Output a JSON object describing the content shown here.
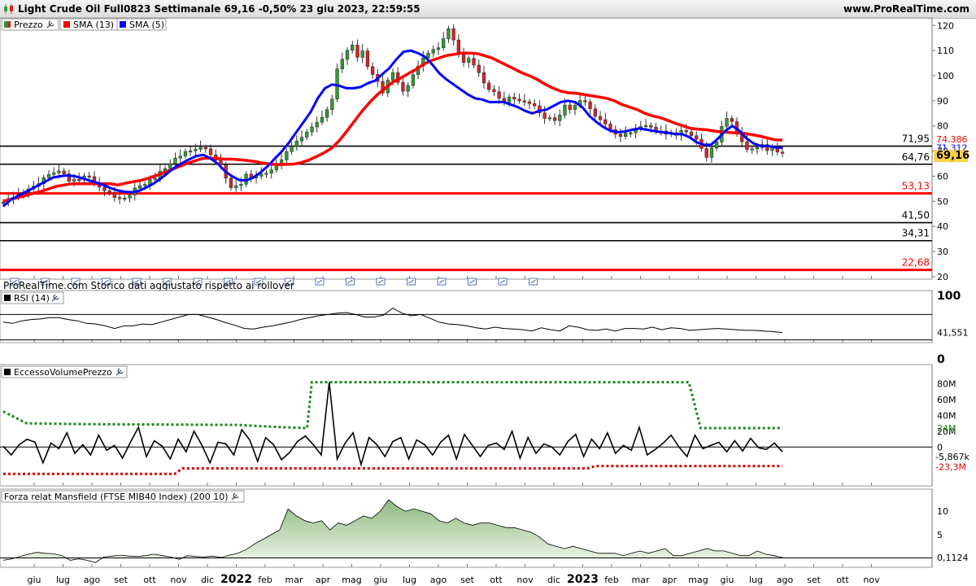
{
  "header": {
    "title": "Light Crude Oil Full0823 Settimanale 69,16 -0,50% 23 giu 2023, 22:59:55",
    "site": "www.ProRealTime.com"
  },
  "colors": {
    "up": "#2e9e2e",
    "down": "#e02020",
    "sma13": "#ff0000",
    "sma5": "#0000ff",
    "hline_black": "#000000",
    "hline_red": "#ff0000",
    "eccesso_line": "#000000",
    "eccesso_upper": "#1a8a1a",
    "eccesso_lower": "#e00000",
    "mansfield_fill": "#b9d6ad",
    "mansfield_line": "#000000",
    "price_label_bg": "#ffd24a"
  },
  "chart_data": [
    {
      "panel": "price",
      "type": "candlestick",
      "legend": [
        {
          "label": "Prezzo",
          "icon": "candle-icon"
        },
        {
          "label": "SMA (13)",
          "color": "#ff0000"
        },
        {
          "label": "SMA (5)",
          "color": "#0000ff"
        }
      ],
      "y_ticks": [
        120,
        110,
        100,
        90,
        80,
        70,
        60,
        50,
        40,
        30,
        20
      ],
      "ylim": [
        19,
        123
      ],
      "x_ticks": [
        "giu",
        "lug",
        "ago",
        "set",
        "ott",
        "nov",
        "dic",
        "2022",
        "feb",
        "mar",
        "apr",
        "mag",
        "giu",
        "lug",
        "ago",
        "set",
        "ott",
        "nov",
        "dic",
        "2023",
        "feb",
        "mar",
        "apr",
        "mag",
        "giu",
        "lug",
        "ago",
        "set",
        "ott",
        "nov"
      ],
      "x_ticks_bold": [
        "2022",
        "2023"
      ],
      "close": [
        49.7,
        51.1,
        51.6,
        52.7,
        53.6,
        54.9,
        56.0,
        57.0,
        59.4,
        60.7,
        61.3,
        62.1,
        60.9,
        58.0,
        58.7,
        58.6,
        60.1,
        59.8,
        57.0,
        55.6,
        54.2,
        53.5,
        51.5,
        51.1,
        51.3,
        52.5,
        55.3,
        56.2,
        56.7,
        58.7,
        59.2,
        62.0,
        63.0,
        65.0,
        67.2,
        68.0,
        69.8,
        70.1,
        70.7,
        71.4,
        70.9,
        68.5,
        66.3,
        64.5,
        59.2,
        55.4,
        56.2,
        56.8,
        60.8,
        59.3,
        60.0,
        60.9,
        61.2,
        62.5,
        64.4,
        66.5,
        69.8,
        71.9,
        74.0,
        75.5,
        77.6,
        79.6,
        81.5,
        83.4,
        86.5,
        90.7,
        102.7,
        106.5,
        110.1,
        112.2,
        107.3,
        109.9,
        103.6,
        100.5,
        97.7,
        93.2,
        98.2,
        101.2,
        97.3,
        93.8,
        96.1,
        100.4,
        103.8,
        107.1,
        109.0,
        110.4,
        111.1,
        114.7,
        118.7,
        114.2,
        108.4,
        105.3,
        106.9,
        104.2,
        101.2,
        97.1,
        94.5,
        93.6,
        91.0,
        89.3,
        91.5,
        90.7,
        90.0,
        89.6,
        88.9,
        88.0,
        85.2,
        83.0,
        83.3,
        82.1,
        84.3,
        88.3,
        86.5,
        88.2,
        90.1,
        89.6,
        86.8,
        83.8,
        82.5,
        80.8,
        78.5,
        76.7,
        75.8,
        77.1,
        77.3,
        79.0,
        79.8,
        80.2,
        79.5,
        77.9,
        78.0,
        76.7,
        77.3,
        76.3,
        78.2,
        77.6,
        76.1,
        74.7,
        71.0,
        67.5,
        71.2,
        73.6,
        79.8,
        83.0,
        81.7,
        77.4,
        73.7,
        70.6,
        70.9,
        71.4,
        72.6,
        70.2,
        71.7,
        69.6,
        69.2
      ],
      "sma13": [
        50.0,
        50.8,
        51.6,
        52.4,
        53.2,
        54.0,
        55.0,
        56.0,
        56.5,
        57.0,
        57.0,
        57.0,
        57.0,
        57.0,
        57.0,
        56.5,
        57.2,
        57.8,
        58.3,
        59.2,
        60.2,
        61.3,
        62.5,
        63.8,
        65.0,
        66.0,
        67.0,
        67.2,
        67.0,
        66.8,
        66.8,
        66.5,
        66.2,
        65.8,
        65.2,
        64.8,
        64.6,
        64.7,
        64.8,
        65.4,
        66.4,
        67.8,
        69.3,
        71.2,
        74.2,
        78.0,
        82.0,
        86.0,
        89.5,
        92.5,
        95.0,
        97.5,
        99.0,
        100.8,
        102.5,
        104.5,
        106.0,
        107.0,
        108.0,
        108.5,
        109.0,
        109.0,
        108.8,
        108.0,
        107.0,
        105.5,
        104.0,
        102.5,
        101.0,
        99.8,
        98.3,
        96.5,
        95.0,
        93.8,
        93.2,
        93.0,
        92.5,
        92.0,
        91.5,
        91.0,
        90.0,
        88.5,
        87.5,
        86.5,
        85.0,
        84.0,
        83.3,
        82.2,
        81.0,
        80.0,
        79.0,
        78.7,
        78.5,
        78.0,
        77.6,
        77.4,
        77.2,
        77.1,
        76.5,
        76.0,
        75.2,
        74.5,
        74.4
      ],
      "sma5": [
        48.0,
        50.5,
        52.0,
        53.5,
        55.0,
        56.5,
        58.0,
        59.5,
        60.0,
        60.3,
        60.0,
        59.2,
        58.3,
        57.5,
        56.5,
        55.3,
        54.3,
        53.8,
        53.6,
        54.2,
        55.5,
        57.0,
        59.0,
        61.2,
        63.5,
        65.2,
        66.7,
        68.0,
        68.5,
        67.0,
        65.0,
        62.0,
        60.0,
        58.5,
        58.3,
        59.5,
        61.5,
        64.0,
        67.0,
        70.0,
        73.5,
        77.5,
        81.5,
        85.5,
        91.0,
        95.0,
        96.5,
        96.0,
        95.0,
        95.0,
        95.5,
        97.0,
        98.0,
        100.5,
        103.0,
        106.5,
        109.5,
        110.0,
        109.0,
        107.5,
        104.5,
        101.0,
        98.5,
        96.5,
        94.5,
        92.5,
        91.0,
        90.5,
        89.5,
        89.5,
        89.5,
        88.5,
        87.5,
        86.0,
        85.0,
        86.0,
        86.5,
        88.0,
        89.5,
        90.0,
        89.5,
        87.5,
        84.0,
        81.5,
        79.5,
        78.0,
        77.5,
        77.8,
        78.5,
        79.0,
        78.5,
        78.0,
        77.5,
        77.3,
        76.8,
        76.7,
        75.5,
        73.5,
        72.5,
        72.5,
        75.0,
        78.0,
        80.0,
        78.0,
        75.0,
        73.0,
        72.0,
        72.0,
        71.5,
        71.3
      ],
      "horizontal_lines": [
        {
          "value": 71.95,
          "label": "71,95",
          "color": "black"
        },
        {
          "value": 64.76,
          "label": "64,76",
          "color": "black"
        },
        {
          "value": 53.13,
          "label": "53,13",
          "color": "red"
        },
        {
          "value": 41.5,
          "label": "41,50",
          "color": "black"
        },
        {
          "value": 34.31,
          "label": "34,31",
          "color": "black"
        },
        {
          "value": 22.68,
          "label": "22,68",
          "color": "red"
        }
      ],
      "value_labels": [
        {
          "text": "74.386",
          "color": "red"
        },
        {
          "text": "71.312",
          "color": "blue"
        },
        {
          "text": "69,16",
          "color": "black"
        }
      ],
      "footnote": "ProRealTime.com  Storico dati aggiustato rispetto ai rollover"
    },
    {
      "panel": "rsi",
      "type": "line",
      "legend": "RSI (14)",
      "y_ticks": [
        100,
        0
      ],
      "ylim": [
        0,
        100
      ],
      "bands": [
        70,
        30
      ],
      "last_label": "41,551",
      "values": [
        58,
        56,
        60,
        62,
        63,
        65,
        65,
        62,
        60,
        56,
        55,
        52,
        48,
        52,
        52,
        55,
        54,
        58,
        62,
        66,
        70,
        70,
        66,
        62,
        57,
        53,
        48,
        47,
        50,
        52,
        55,
        58,
        62,
        65,
        68,
        70,
        72,
        73,
        70,
        66,
        66,
        69,
        80,
        72,
        68,
        70,
        64,
        58,
        55,
        54,
        52,
        49,
        47,
        50,
        48,
        47,
        46,
        44,
        49,
        46,
        44,
        52,
        50,
        46,
        45,
        47,
        44,
        48,
        48,
        47,
        50,
        46,
        49,
        48,
        45,
        46,
        47,
        48,
        47,
        46,
        45,
        45,
        44,
        43,
        41.5
      ]
    },
    {
      "panel": "eccesso",
      "type": "line",
      "legend": "EccessoVolumePrezzo",
      "y_ticks": [
        "80M",
        "60M",
        "40M",
        "20M",
        "0"
      ],
      "ylim": [
        -45,
        96
      ],
      "labels": [
        {
          "text": "24M",
          "color": "#1a8a1a"
        },
        {
          "text": "-5,867k",
          "color": "black"
        },
        {
          "text": "-23,3M",
          "color": "red"
        }
      ],
      "values": [
        1,
        -10,
        3,
        10,
        6,
        -20,
        5,
        -2,
        18,
        -8,
        3,
        -10,
        15,
        -4,
        2,
        -14,
        6,
        25,
        -12,
        8,
        1,
        -15,
        10,
        -6,
        20,
        2,
        -20,
        6,
        4,
        -10,
        22,
        9,
        -18,
        12,
        3,
        -16,
        -7,
        7,
        14,
        3,
        -10,
        82,
        -15,
        5,
        18,
        -22,
        12,
        3,
        -12,
        7,
        12,
        -15,
        9,
        3,
        -10,
        6,
        15,
        -15,
        16,
        2,
        -12,
        2,
        5,
        -3,
        20,
        -14,
        12,
        -8,
        4,
        0,
        -10,
        7,
        16,
        -12,
        10,
        -2,
        18,
        -8,
        2,
        -4,
        25,
        -10,
        -3,
        5,
        15,
        0,
        -12,
        15,
        -2,
        2,
        6,
        -6,
        8,
        -5,
        11,
        -1,
        -3,
        5,
        -6
      ],
      "upper": [
        [
          0,
          45
        ],
        [
          0.03,
          30
        ],
        [
          0.1,
          29
        ],
        [
          0.3,
          28
        ],
        [
          0.36,
          25
        ],
        [
          0.39,
          24
        ],
        [
          0.396,
          82
        ],
        [
          0.88,
          82
        ],
        [
          0.895,
          24
        ],
        [
          1,
          24
        ]
      ],
      "lower": [
        [
          0,
          -34
        ],
        [
          0.22,
          -34
        ],
        [
          0.23,
          -27
        ],
        [
          0.37,
          -27
        ],
        [
          0.75,
          -27
        ],
        [
          0.76,
          -24
        ],
        [
          1,
          -24
        ]
      ]
    },
    {
      "panel": "mansfield",
      "type": "area",
      "legend": "Forza relat Mansfield (FTSE MIB40 Index) (200 10)",
      "y_ticks": [
        10,
        5
      ],
      "ylim": [
        -2,
        13
      ],
      "last_label": "0,1124",
      "values": [
        -0.5,
        -0.2,
        0.3,
        0.8,
        1.2,
        1.0,
        0.9,
        0.5,
        -0.5,
        -0.2,
        -0.5,
        -1.0,
        0.2,
        0.4,
        0.6,
        0.4,
        0.3,
        0.5,
        0.8,
        0.5,
        0.2,
        -0.3,
        0.5,
        0.3,
        0.2,
        0.4,
        0.1,
        0.6,
        1.0,
        1.8,
        3.0,
        4.0,
        5.0,
        6.0,
        10.5,
        9.0,
        8.0,
        7.5,
        8.0,
        6.0,
        7.5,
        7.0,
        8.0,
        9.0,
        8.5,
        10.0,
        12.5,
        11.0,
        10.0,
        10.5,
        10.0,
        9.5,
        8.0,
        7.5,
        8.5,
        7.5,
        7.0,
        7.5,
        7.5,
        7.0,
        6.5,
        6.5,
        6.0,
        5.5,
        4.5,
        3.0,
        2.5,
        2.0,
        2.5,
        2.0,
        1.5,
        1.0,
        1.0,
        1.0,
        0.5,
        1.0,
        1.5,
        1.0,
        1.5,
        2.0,
        0.5,
        0.5,
        1.0,
        1.5,
        2.0,
        1.5,
        1.5,
        1.0,
        0.5,
        0.5,
        1.5,
        0.8,
        0.5,
        0.1
      ]
    }
  ]
}
